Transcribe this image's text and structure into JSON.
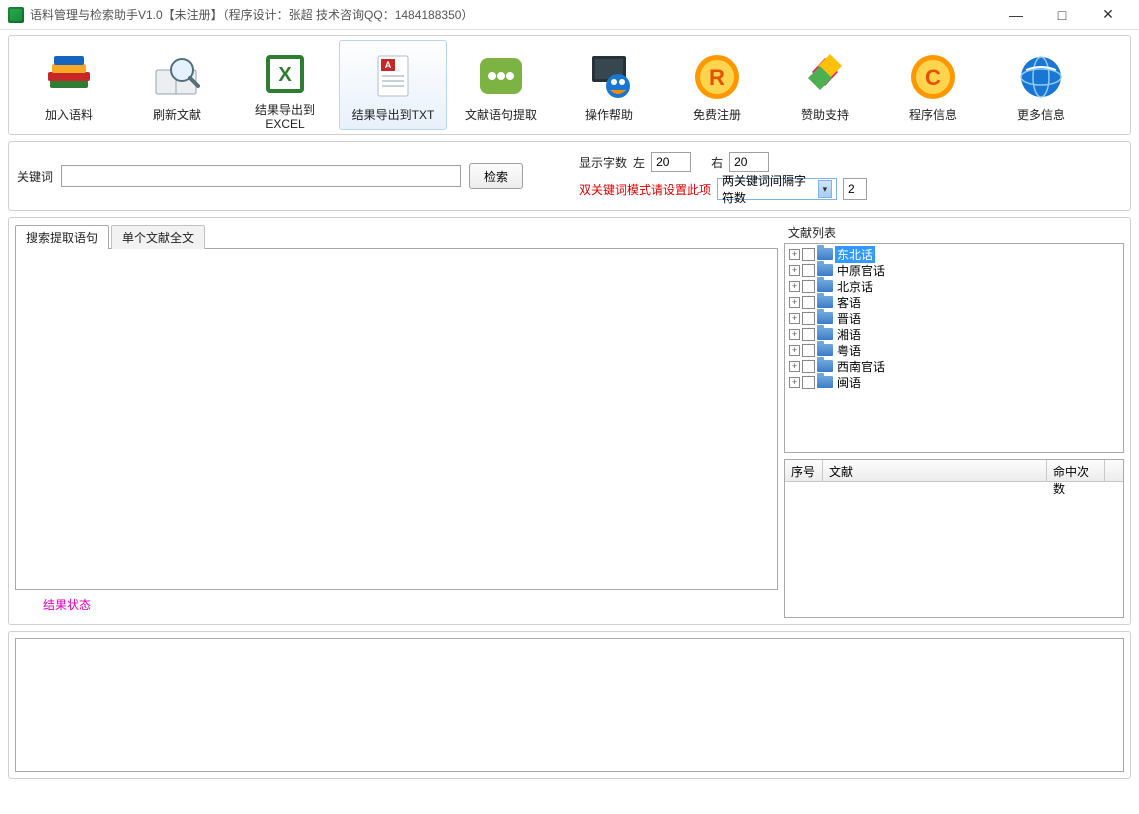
{
  "title": "语料管理与检索助手V1.0【未注册】（程序设计：张超  技术咨询QQ：1484188350）",
  "window": {
    "min": "—",
    "max": "□",
    "close": "✕"
  },
  "toolbar": [
    {
      "id": "add-corpus",
      "label": "加入语料"
    },
    {
      "id": "refresh-docs",
      "label": "刷新文献"
    },
    {
      "id": "export-excel",
      "label": "结果导出到\nEXCEL"
    },
    {
      "id": "export-txt",
      "label": "结果导出到TXT"
    },
    {
      "id": "extract-sentences",
      "label": "文献语句提取"
    },
    {
      "id": "help",
      "label": "操作帮助"
    },
    {
      "id": "register",
      "label": "免费注册"
    },
    {
      "id": "donate",
      "label": "赞助支持"
    },
    {
      "id": "program-info",
      "label": "程序信息"
    },
    {
      "id": "more-info",
      "label": "更多信息"
    }
  ],
  "search": {
    "keyword_label": "关键词",
    "keyword_value": "",
    "search_btn": "检索",
    "display_chars_label": "显示字数",
    "left_label": "左",
    "left_value": "20",
    "right_label": "右",
    "right_value": "20",
    "dual_hint": "双关键词模式请设置此项",
    "combo_label": "两关键词间隔字符数",
    "combo_side_value": "2"
  },
  "tabs": {
    "t1": "搜索提取语句",
    "t2": "单个文献全文"
  },
  "status": "结果状态",
  "tree_label": "文献列表",
  "tree": [
    "东北话",
    "中原官话",
    "北京话",
    "客语",
    "晋语",
    "湘语",
    "粤语",
    "西南官话",
    "闽语"
  ],
  "grid": {
    "h1": "序号",
    "h2": "文献",
    "h3": "命中次数"
  }
}
